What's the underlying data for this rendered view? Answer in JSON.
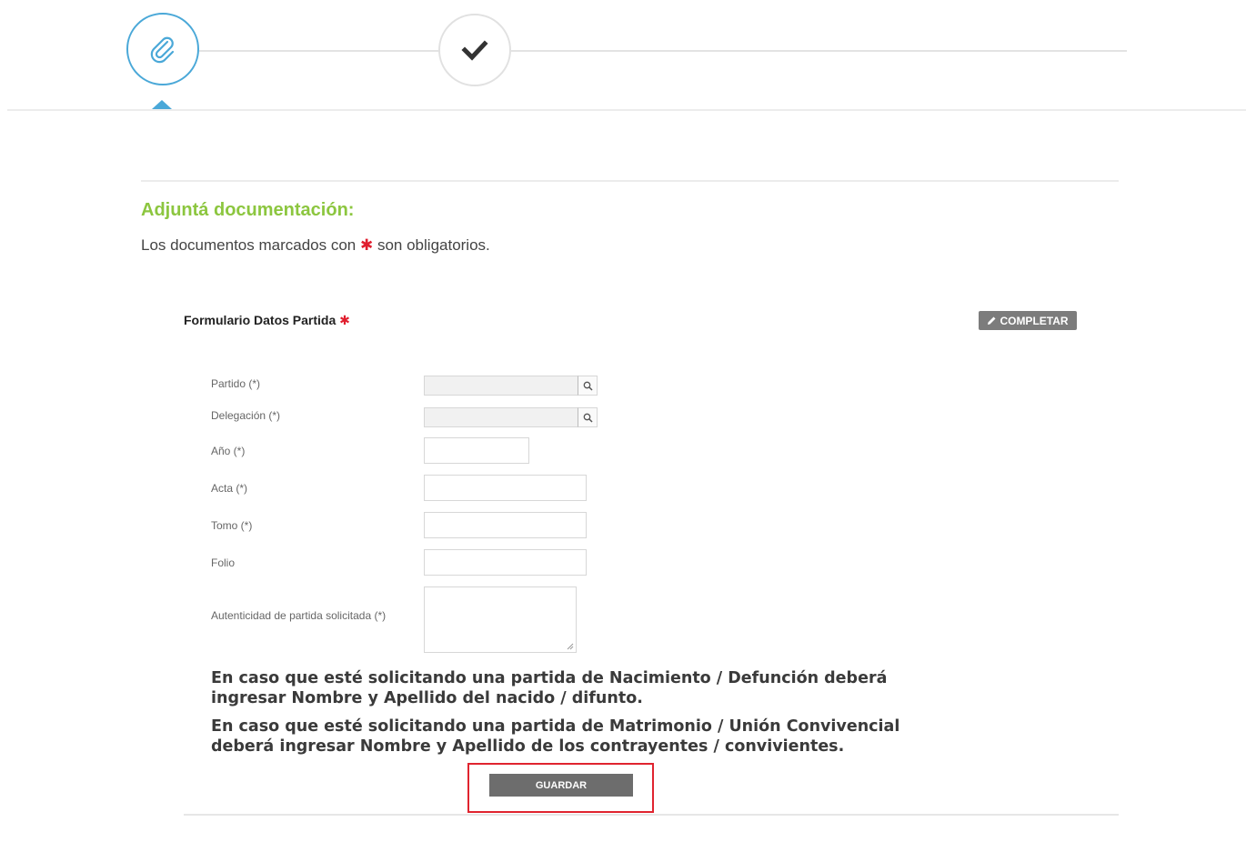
{
  "stepper": {
    "steps": [
      {
        "icon": "paperclip-icon",
        "state": "active"
      },
      {
        "icon": "checkmark-icon",
        "state": "pending"
      }
    ],
    "accent_color": "#4aa8d8"
  },
  "section": {
    "title": "Adjuntá documentación:",
    "desc_before": "Los documentos marcados con",
    "required_mark": "✱",
    "desc_after": "son obligatorios."
  },
  "form": {
    "title": "Formulario Datos Partida",
    "required_mark": "✱",
    "completar_label": "COMPLETAR",
    "fields": {
      "partido": {
        "label": "Partido (*)",
        "value": ""
      },
      "delegacion": {
        "label": "Delegación (*)",
        "value": ""
      },
      "anio": {
        "label": "Año (*)",
        "value": ""
      },
      "acta": {
        "label": "Acta (*)",
        "value": ""
      },
      "tomo": {
        "label": "Tomo (*)",
        "value": ""
      },
      "folio": {
        "label": "Folio",
        "value": ""
      },
      "autenticidad": {
        "label": "Autenticidad de partida solicitada (*)",
        "value": ""
      }
    },
    "note_1": "En caso que esté solicitando una partida de Nacimiento / Defunción deberá ingresar Nombre y Apellido del nacido / difunto.",
    "note_2": "En caso que esté solicitando una partida de Matrimonio / Unión Convivencial deberá ingresar Nombre y Apellido de los contrayentes / convivientes.",
    "save_label": "GUARDAR"
  },
  "colors": {
    "title_green": "#8cc63f",
    "required_red": "#e01e2e",
    "highlight_red": "#e0242f"
  }
}
